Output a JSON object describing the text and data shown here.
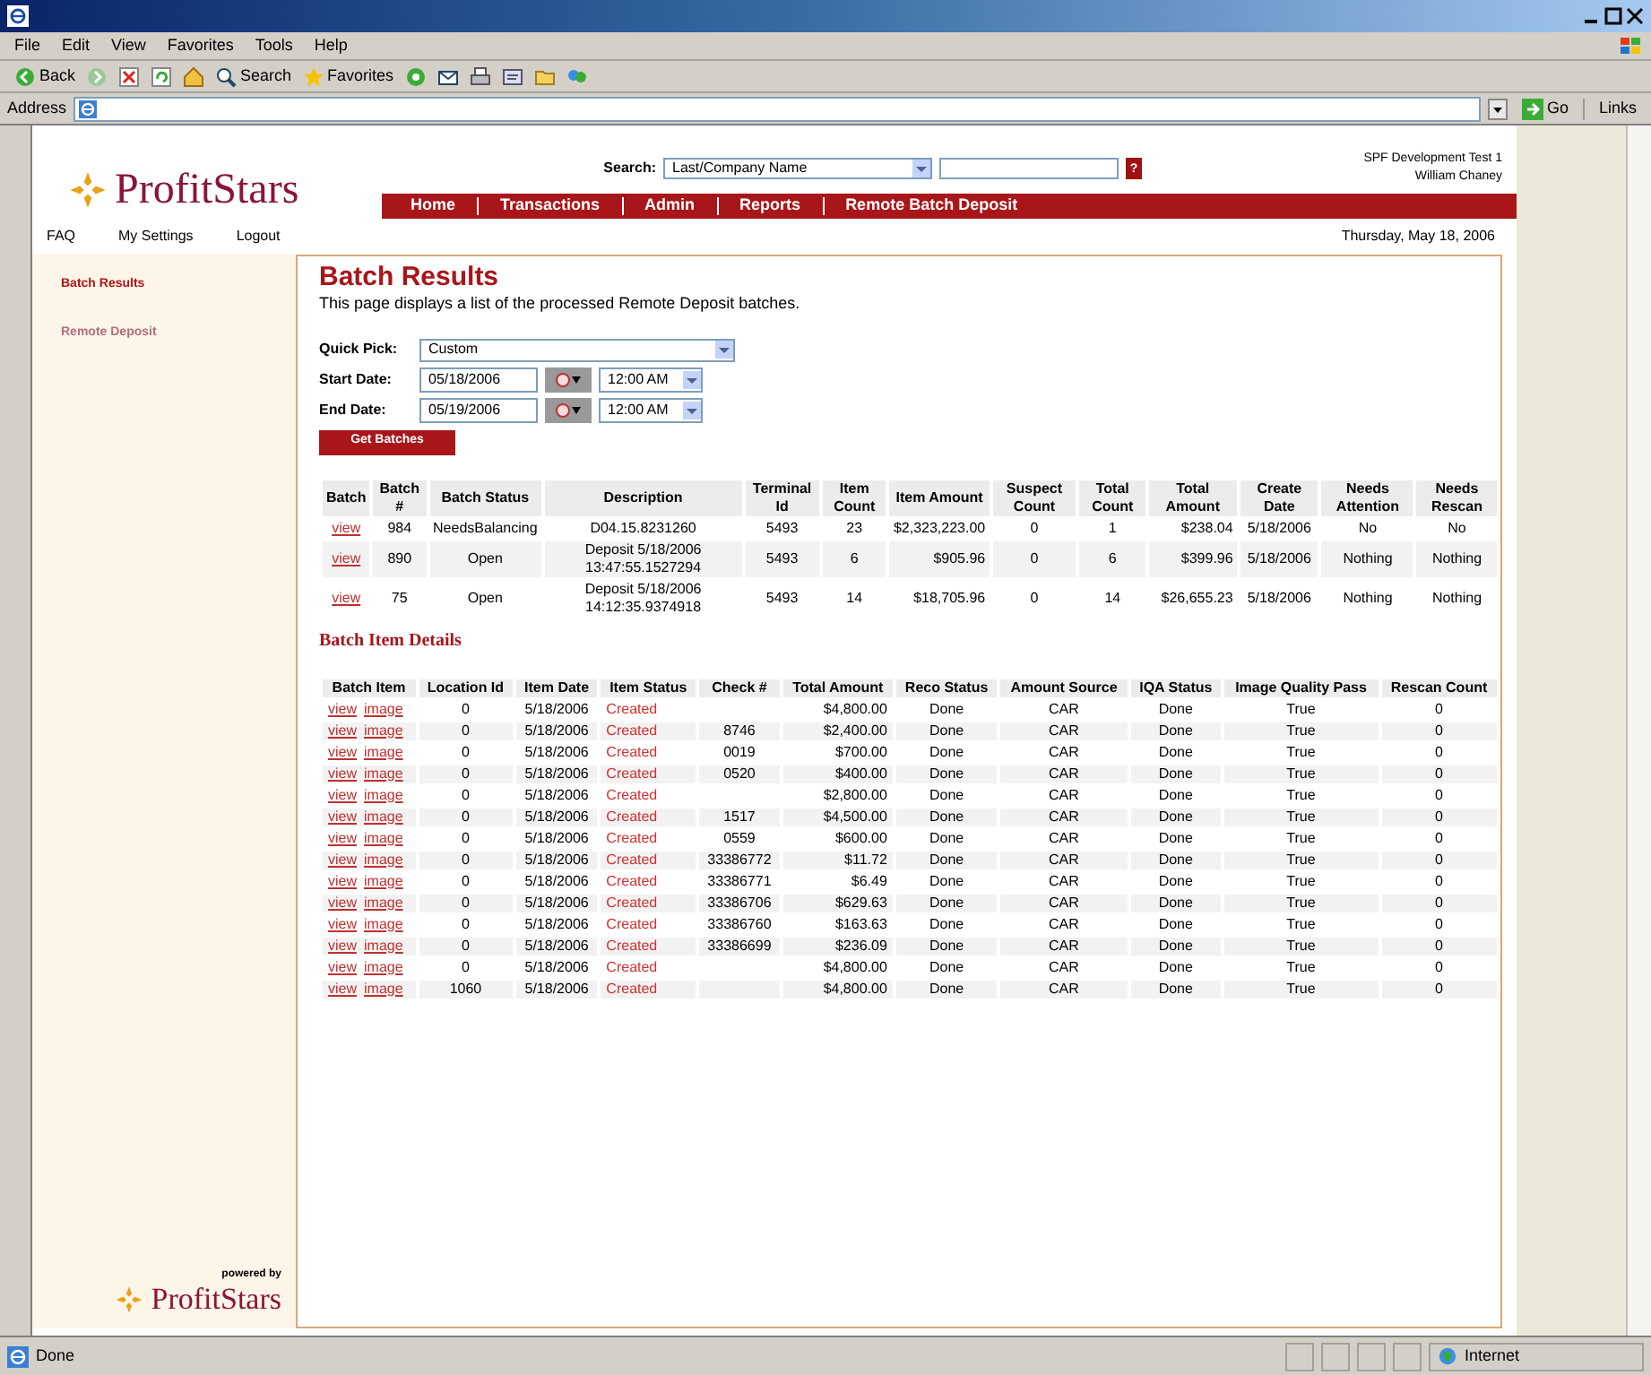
{
  "menu": [
    "File",
    "Edit",
    "View",
    "Favorites",
    "Tools",
    "Help"
  ],
  "toolbar": [
    {
      "kind": "back",
      "label": "Back"
    },
    {
      "kind": "forward"
    },
    {
      "kind": "stop"
    },
    {
      "kind": "refresh"
    },
    {
      "kind": "home"
    },
    {
      "kind": "search",
      "label": "Search"
    },
    {
      "kind": "favorites",
      "label": "Favorites"
    },
    {
      "kind": "media"
    },
    {
      "kind": "mail"
    },
    {
      "kind": "print"
    },
    {
      "kind": "edit"
    },
    {
      "kind": "folder"
    },
    {
      "kind": "messenger"
    }
  ],
  "address_bar": {
    "label": "Address",
    "go": "Go",
    "links": "Links"
  },
  "header": {
    "logo": "ProfitStars",
    "search_label": "Search:",
    "search_select": "Last/Company Name",
    "help": "?",
    "account": [
      "SPF Development Test 1",
      "William Chaney"
    ],
    "nav": [
      "Home",
      "Transactions",
      "Admin",
      "Reports",
      "Remote Batch Deposit"
    ],
    "top_links": [
      "FAQ",
      "My Settings",
      "Logout"
    ],
    "date": "Thursday, May 18, 2006"
  },
  "sidebar": {
    "items": [
      {
        "label": "Batch Results",
        "selected": true
      },
      {
        "label": "Remote Deposit",
        "selected": false
      }
    ],
    "powered_by": "powered by",
    "logo": "ProfitStars"
  },
  "panel": {
    "title": "Batch Results",
    "description": "This page displays a list of the processed Remote Deposit batches.",
    "quick_pick": {
      "label": "Quick Pick:",
      "value": "Custom"
    },
    "start": {
      "label": "Start Date:",
      "date": "05/18/2006",
      "time": "12:00 AM"
    },
    "end": {
      "label": "End Date:",
      "date": "05/19/2006",
      "time": "12:00 AM"
    },
    "button": "Get Batches",
    "batches": {
      "columns": [
        "Batch",
        "Batch #",
        "Batch Status",
        "Description",
        "Terminal Id",
        "Item Count",
        "Item Amount",
        "Suspect Count",
        "Total Count",
        "Total Amount",
        "Create Date",
        "Needs Attention",
        "Needs Rescan"
      ],
      "rows": [
        [
          "view",
          "984",
          "NeedsBalancing",
          "D04.15.8231260",
          "5493",
          "23",
          "$2,323,223.00",
          "0",
          "1",
          "$238.04",
          "5/18/2006",
          "No",
          "No"
        ],
        [
          "view",
          "890",
          "Open",
          "Deposit 5/18/2006 13:47:55.1527294",
          "5493",
          "6",
          "$905.96",
          "0",
          "6",
          "$399.96",
          "5/18/2006",
          "Nothing",
          "Nothing"
        ],
        [
          "view",
          "75",
          "Open",
          "Deposit 5/18/2006 14:12:35.9374918",
          "5493",
          "14",
          "$18,705.96",
          "0",
          "14",
          "$26,655.23",
          "5/18/2006",
          "Nothing",
          "Nothing"
        ]
      ]
    },
    "items_title": "Batch Item Details",
    "items": {
      "columns": [
        "Batch Item",
        "Location Id",
        "Item Date",
        "Item Status",
        "Check #",
        "Total Amount",
        "Reco Status",
        "Amount Source",
        "IQA Status",
        "Image Quality Pass",
        "Rescan Count"
      ],
      "rows": [
        [
          [
            "view",
            "image"
          ],
          "0",
          "5/18/2006",
          "Created",
          "",
          "$4,800.00",
          "Done",
          "CAR",
          "Done",
          "True",
          "0"
        ],
        [
          [
            "view",
            "image"
          ],
          "0",
          "5/18/2006",
          "Created",
          "8746",
          "$2,400.00",
          "Done",
          "CAR",
          "Done",
          "True",
          "0"
        ],
        [
          [
            "view",
            "image"
          ],
          "0",
          "5/18/2006",
          "Created",
          "0019",
          "$700.00",
          "Done",
          "CAR",
          "Done",
          "True",
          "0"
        ],
        [
          [
            "view",
            "image"
          ],
          "0",
          "5/18/2006",
          "Created",
          "0520",
          "$400.00",
          "Done",
          "CAR",
          "Done",
          "True",
          "0"
        ],
        [
          [
            "view",
            "image"
          ],
          "0",
          "5/18/2006",
          "Created",
          "",
          "$2,800.00",
          "Done",
          "CAR",
          "Done",
          "True",
          "0"
        ],
        [
          [
            "view",
            "image"
          ],
          "0",
          "5/18/2006",
          "Created",
          "1517",
          "$4,500.00",
          "Done",
          "CAR",
          "Done",
          "True",
          "0"
        ],
        [
          [
            "view",
            "image"
          ],
          "0",
          "5/18/2006",
          "Created",
          "0559",
          "$600.00",
          "Done",
          "CAR",
          "Done",
          "True",
          "0"
        ],
        [
          [
            "view",
            "image"
          ],
          "0",
          "5/18/2006",
          "Created",
          "33386772",
          "$11.72",
          "Done",
          "CAR",
          "Done",
          "True",
          "0"
        ],
        [
          [
            "view",
            "image"
          ],
          "0",
          "5/18/2006",
          "Created",
          "33386771",
          "$6.49",
          "Done",
          "CAR",
          "Done",
          "True",
          "0"
        ],
        [
          [
            "view",
            "image"
          ],
          "0",
          "5/18/2006",
          "Created",
          "33386706",
          "$629.63",
          "Done",
          "CAR",
          "Done",
          "True",
          "0"
        ],
        [
          [
            "view",
            "image"
          ],
          "0",
          "5/18/2006",
          "Created",
          "33386760",
          "$163.63",
          "Done",
          "CAR",
          "Done",
          "True",
          "0"
        ],
        [
          [
            "view",
            "image"
          ],
          "0",
          "5/18/2006",
          "Created",
          "33386699",
          "$236.09",
          "Done",
          "CAR",
          "Done",
          "True",
          "0"
        ],
        [
          [
            "view",
            "image"
          ],
          "0",
          "5/18/2006",
          "Created",
          "",
          "$4,800.00",
          "Done",
          "CAR",
          "Done",
          "True",
          "0"
        ],
        [
          [
            "view",
            "image"
          ],
          "1060",
          "5/18/2006",
          "Created",
          "",
          "$4,800.00",
          "Done",
          "CAR",
          "Done",
          "True",
          "0"
        ]
      ]
    }
  },
  "status_bar": {
    "text": "Done",
    "zone": "Internet"
  }
}
